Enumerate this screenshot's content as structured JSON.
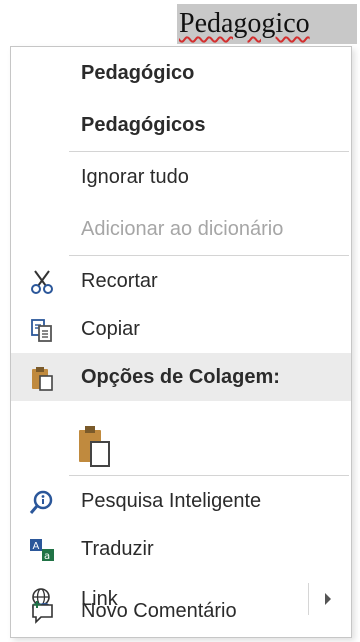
{
  "document": {
    "word": "Pedagogico"
  },
  "menu": {
    "suggestions": [
      "Pedagógico",
      "Pedagógicos"
    ],
    "ignore_all": "Ignorar tudo",
    "add_to_dictionary": "Adicionar ao dicionário",
    "cut": "Recortar",
    "copy": "Copiar",
    "paste_options_header": "Opções de Colagem:",
    "smart_lookup": "Pesquisa Inteligente",
    "translate": "Traduzir",
    "link": "Link",
    "new_comment": "Novo Comentário"
  },
  "colors": {
    "accent_blue": "#2b579a",
    "clipboard_orange": "#c08a3e",
    "misspell_red": "#d32f2f",
    "translate_green": "#217346"
  }
}
